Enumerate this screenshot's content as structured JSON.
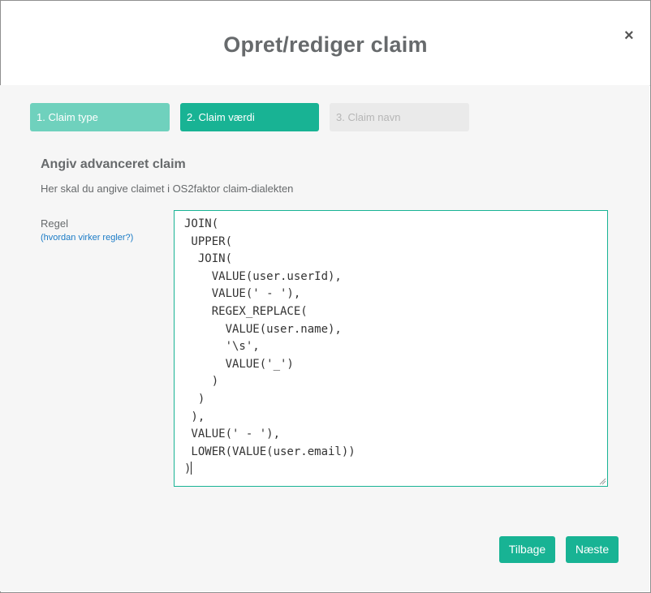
{
  "dialog": {
    "title": "Opret/rediger claim",
    "close_glyph": "×"
  },
  "steps": [
    {
      "label": "1. Claim type",
      "state": "done"
    },
    {
      "label": "2. Claim værdi",
      "state": "active"
    },
    {
      "label": "3. Claim navn",
      "state": "pending"
    }
  ],
  "section": {
    "title": "Angiv advanceret claim",
    "description": "Her skal du angive claimet i OS2faktor claim-dialekten"
  },
  "rule": {
    "label": "Regel",
    "help_link": "(hvordan virker regler?)",
    "value": "JOIN(\n UPPER(\n  JOIN(\n    VALUE(user.userId),\n    VALUE(' - '),\n    REGEX_REPLACE(\n      VALUE(user.name),\n      '\\s',\n      VALUE('_')\n    )\n  )\n ),\n VALUE(' - '),\n LOWER(VALUE(user.email))\n)"
  },
  "buttons": {
    "back": "Tilbage",
    "next": "Næste"
  },
  "colors": {
    "accent": "#18b394",
    "step_done": "#6fd1bd",
    "step_pending": "#eaeaea",
    "link": "#1a7bc6"
  }
}
